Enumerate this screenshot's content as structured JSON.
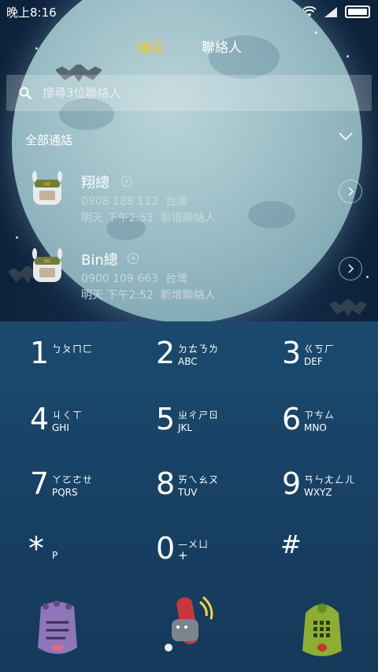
{
  "status": {
    "time": "晚上8:16"
  },
  "tabs": {
    "calls": "通話",
    "contacts": "聯絡人"
  },
  "search": {
    "placeholder": "搜尋3位聯絡人"
  },
  "filter": {
    "label": "全部通話"
  },
  "calls": [
    {
      "name": "翔總",
      "number": "0908 188 112",
      "region": "台灣",
      "time": "明天 下午2:53",
      "note": "新增聯絡人"
    },
    {
      "name": "Bin總",
      "number": "0900 109 663",
      "region": "台灣",
      "time": "明天 下午2:52",
      "note": "新增聯絡人"
    }
  ],
  "keys": {
    "k1": {
      "digit": "1",
      "bpm": "ㄅㄆㄇㄈ",
      "abc": ""
    },
    "k2": {
      "digit": "2",
      "bpm": "ㄉㄊㄋㄌ",
      "abc": "ABC"
    },
    "k3": {
      "digit": "3",
      "bpm": "ㄍㄎㄏ",
      "abc": "DEF"
    },
    "k4": {
      "digit": "4",
      "bpm": "ㄐㄑㄒ",
      "abc": "GHI"
    },
    "k5": {
      "digit": "5",
      "bpm": "ㄓㄔㄕㄖ",
      "abc": "JKL"
    },
    "k6": {
      "digit": "6",
      "bpm": "ㄗㄘㄙ",
      "abc": "MNO"
    },
    "k7": {
      "digit": "7",
      "bpm": "ㄚㄛㄜㄝ",
      "abc": "PQRS"
    },
    "k8": {
      "digit": "8",
      "bpm": "ㄞㄟㄠㄡ",
      "abc": "TUV"
    },
    "k9": {
      "digit": "9",
      "bpm": "ㄢㄣㄤㄥㄦ",
      "abc": "WXYZ"
    },
    "kstar": {
      "digit": "*",
      "abc": "P"
    },
    "k0": {
      "digit": "0",
      "bpm": "—ㄨㄩ",
      "abc": "+"
    },
    "khash": {
      "digit": "#"
    }
  },
  "colors": {
    "active_tab": "#f2c33a",
    "dialpad_bg": "#1b4a6e"
  }
}
